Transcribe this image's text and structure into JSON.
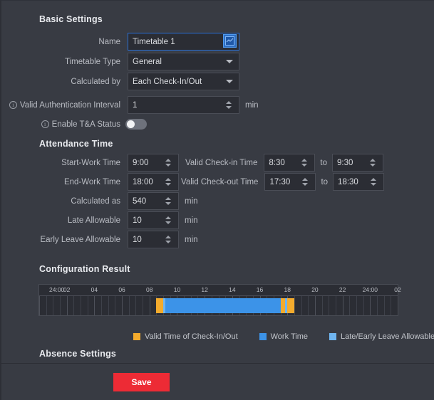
{
  "sections": {
    "basic": "Basic Settings",
    "attendance": "Attendance Time",
    "config_result": "Configuration Result",
    "absence": "Absence Settings"
  },
  "basic": {
    "name_label": "Name",
    "name_value": "Timetable 1",
    "swatch_icon": "color-swatch-icon",
    "type_label": "Timetable Type",
    "type_value": "General",
    "calculated_by_label": "Calculated by",
    "calculated_by_value": "Each Check-In/Out",
    "interval_label": "Valid Authentication Interval",
    "interval_value": "1",
    "interval_unit": "min",
    "ta_status_label": "Enable T&A Status",
    "ta_status_on": false,
    "info_glyph": "i"
  },
  "attendance": {
    "start_work_label": "Start-Work Time",
    "start_work_value": "9:00",
    "end_work_label": "End-Work Time",
    "end_work_value": "18:00",
    "calculated_as_label": "Calculated as",
    "calculated_as_value": "540",
    "calculated_as_unit": "min",
    "late_allow_label": "Late Allowable",
    "late_allow_value": "10",
    "late_allow_unit": "min",
    "early_leave_label": "Early Leave Allowable",
    "early_leave_value": "10",
    "early_leave_unit": "min",
    "valid_checkin_label": "Valid Check-in Time",
    "valid_checkin_from": "8:30",
    "valid_checkin_to": "9:30",
    "valid_checkout_label": "Valid Check-out Time",
    "valid_checkout_from": "17:30",
    "valid_checkout_to": "18:30",
    "to_separator": "to"
  },
  "timeline": {
    "ticks": [
      "24:00",
      "02",
      "04",
      "06",
      "08",
      "10",
      "12",
      "14",
      "16",
      "18",
      "20",
      "22",
      "24:00",
      "02"
    ],
    "segments": [
      {
        "name": "valid-check-in-window",
        "kind": "valid",
        "start_hour": 8.5,
        "end_hour": 9.5
      },
      {
        "name": "work-time",
        "kind": "work",
        "start_hour": 9.0,
        "end_hour": 18.0
      },
      {
        "name": "valid-check-out-window",
        "kind": "valid",
        "start_hour": 17.5,
        "end_hour": 18.5
      },
      {
        "name": "late-allowable",
        "kind": "allow",
        "start_hour": 9.0,
        "end_hour": 9.17
      },
      {
        "name": "early-leave-allowable",
        "kind": "allow",
        "start_hour": 17.83,
        "end_hour": 18.0
      }
    ],
    "axis_start_hour": 0,
    "axis_end_hour": 26,
    "legend": [
      {
        "label": "Valid Time of Check-In/Out",
        "color": "#f3ab2d"
      },
      {
        "label": "Work Time",
        "color": "#3c93e8"
      },
      {
        "label": "Late/Early Leave Allowable",
        "color": "#6fb5f0"
      }
    ]
  },
  "footer": {
    "save_label": "Save"
  },
  "colors": {
    "accent_red": "#ed2b35",
    "accent_blue": "#3c93e8",
    "accent_orange": "#f3ab2d",
    "panel_bg": "#383b43",
    "input_bg": "#2b2d34"
  }
}
